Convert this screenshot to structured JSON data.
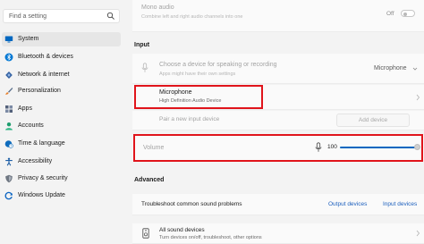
{
  "search": {
    "placeholder": "Find a setting"
  },
  "sidebar": {
    "items": [
      {
        "label": "System",
        "selected": true,
        "icon": "monitor-icon",
        "color": "#0067c0"
      },
      {
        "label": "Bluetooth & devices",
        "selected": false,
        "icon": "bluetooth-icon",
        "color": "#0078d4"
      },
      {
        "label": "Network & internet",
        "selected": false,
        "icon": "wifi-icon",
        "color": "#2f5d9f"
      },
      {
        "label": "Personalization",
        "selected": false,
        "icon": "brush-icon",
        "color": "#e8802a"
      },
      {
        "label": "Apps",
        "selected": false,
        "icon": "apps-icon",
        "color": "#52607a"
      },
      {
        "label": "Accounts",
        "selected": false,
        "icon": "person-icon",
        "color": "#1e9d6e"
      },
      {
        "label": "Time & language",
        "selected": false,
        "icon": "clock-globe-icon",
        "color": "#0f6cbd"
      },
      {
        "label": "Accessibility",
        "selected": false,
        "icon": "accessibility-icon",
        "color": "#1f5fa6"
      },
      {
        "label": "Privacy & security",
        "selected": false,
        "icon": "shield-icon",
        "color": "#6f7782"
      },
      {
        "label": "Windows Update",
        "selected": false,
        "icon": "windows-update-icon",
        "color": "#0a64c2"
      }
    ]
  },
  "main": {
    "mono_audio": {
      "title": "Mono audio",
      "subtitle": "Combine left and right audio channels into one",
      "toggle_label": "Off"
    },
    "input_section": "Input",
    "choose_device": {
      "title": "Choose a device for speaking or recording",
      "subtitle": "Apps might have their own settings",
      "value": "Microphone"
    },
    "microphone": {
      "title": "Microphone",
      "subtitle": "High Definition Audio Device"
    },
    "pair": {
      "title": "Pair a new input device",
      "button": "Add device"
    },
    "volume": {
      "label": "Volume",
      "value": "100",
      "level": 1.0
    },
    "advanced_section": "Advanced",
    "troubleshoot": {
      "title": "Troubleshoot common sound problems",
      "output": "Output devices",
      "input": "Input devices"
    },
    "all_devices": {
      "title": "All sound devices",
      "subtitle": "Turn devices on/off, troubleshoot, other options"
    }
  },
  "colors": {
    "accent": "#0067c0",
    "highlight_box": "#e0141b",
    "link": "#1c5fbd"
  }
}
